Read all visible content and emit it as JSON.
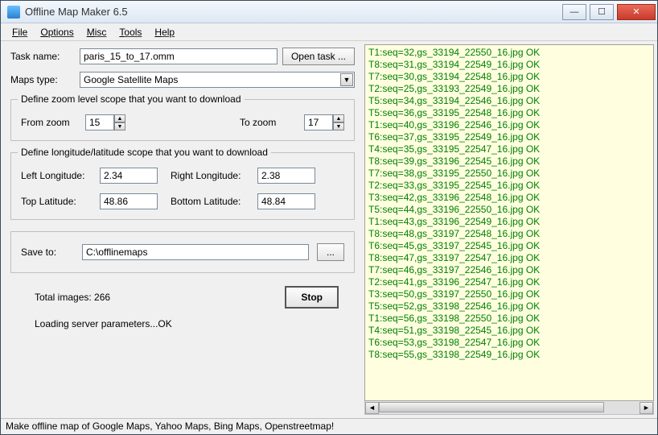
{
  "window": {
    "title": "Offline Map Maker 6.5"
  },
  "menu": [
    "File",
    "Options",
    "Misc",
    "Tools",
    "Help"
  ],
  "form": {
    "task_label": "Task name:",
    "task_value": "paris_15_to_17.omm",
    "open_task_btn": "Open task ...",
    "maps_type_label": "Maps type:",
    "maps_type_value": "Google Satellite Maps",
    "zoom_legend": "Define zoom level scope that you want to download",
    "from_zoom_label": "From zoom",
    "from_zoom_value": "15",
    "to_zoom_label": "To zoom",
    "to_zoom_value": "17",
    "latlon_legend": "Define longitude/latitude scope that you want to download",
    "left_lon_label": "Left Longitude:",
    "left_lon_value": "2.34",
    "right_lon_label": "Right Longitude:",
    "right_lon_value": "2.38",
    "top_lat_label": "Top Latitude:",
    "top_lat_value": "48.86",
    "bottom_lat_label": "Bottom Latitude:",
    "bottom_lat_value": "48.84",
    "save_to_label": "Save to:",
    "save_to_value": "C:\\offlinemaps",
    "browse_btn": "...",
    "total_images_label": "Total images: 266",
    "stop_btn": "Stop",
    "loading_text": "Loading server parameters...OK"
  },
  "log": [
    "T1:seq=32,gs_33194_22550_16.jpg OK",
    "T8:seq=31,gs_33194_22549_16.jpg OK",
    "T7:seq=30,gs_33194_22548_16.jpg OK",
    "T2:seq=25,gs_33193_22549_16.jpg OK",
    "T5:seq=34,gs_33194_22546_16.jpg OK",
    "T5:seq=36,gs_33195_22548_16.jpg OK",
    "T1:seq=40,gs_33196_22546_16.jpg OK",
    "T6:seq=37,gs_33195_22549_16.jpg OK",
    "T4:seq=35,gs_33195_22547_16.jpg OK",
    "T8:seq=39,gs_33196_22545_16.jpg OK",
    "T7:seq=38,gs_33195_22550_16.jpg OK",
    "T2:seq=33,gs_33195_22545_16.jpg OK",
    "T3:seq=42,gs_33196_22548_16.jpg OK",
    "T5:seq=44,gs_33196_22550_16.jpg OK",
    "T1:seq=43,gs_33196_22549_16.jpg OK",
    "T8:seq=48,gs_33197_22548_16.jpg OK",
    "T6:seq=45,gs_33197_22545_16.jpg OK",
    "T8:seq=47,gs_33197_22547_16.jpg OK",
    "T7:seq=46,gs_33197_22546_16.jpg OK",
    "T2:seq=41,gs_33196_22547_16.jpg OK",
    "T3:seq=50,gs_33197_22550_16.jpg OK",
    "T5:seq=52,gs_33198_22546_16.jpg OK",
    "T1:seq=56,gs_33198_22550_16.jpg OK",
    "T4:seq=51,gs_33198_22545_16.jpg OK",
    "T6:seq=53,gs_33198_22547_16.jpg OK",
    "T8:seq=55,gs_33198_22549_16.jpg OK"
  ],
  "statusbar": "Make offline map of Google Maps, Yahoo Maps, Bing Maps, Openstreetmap!"
}
